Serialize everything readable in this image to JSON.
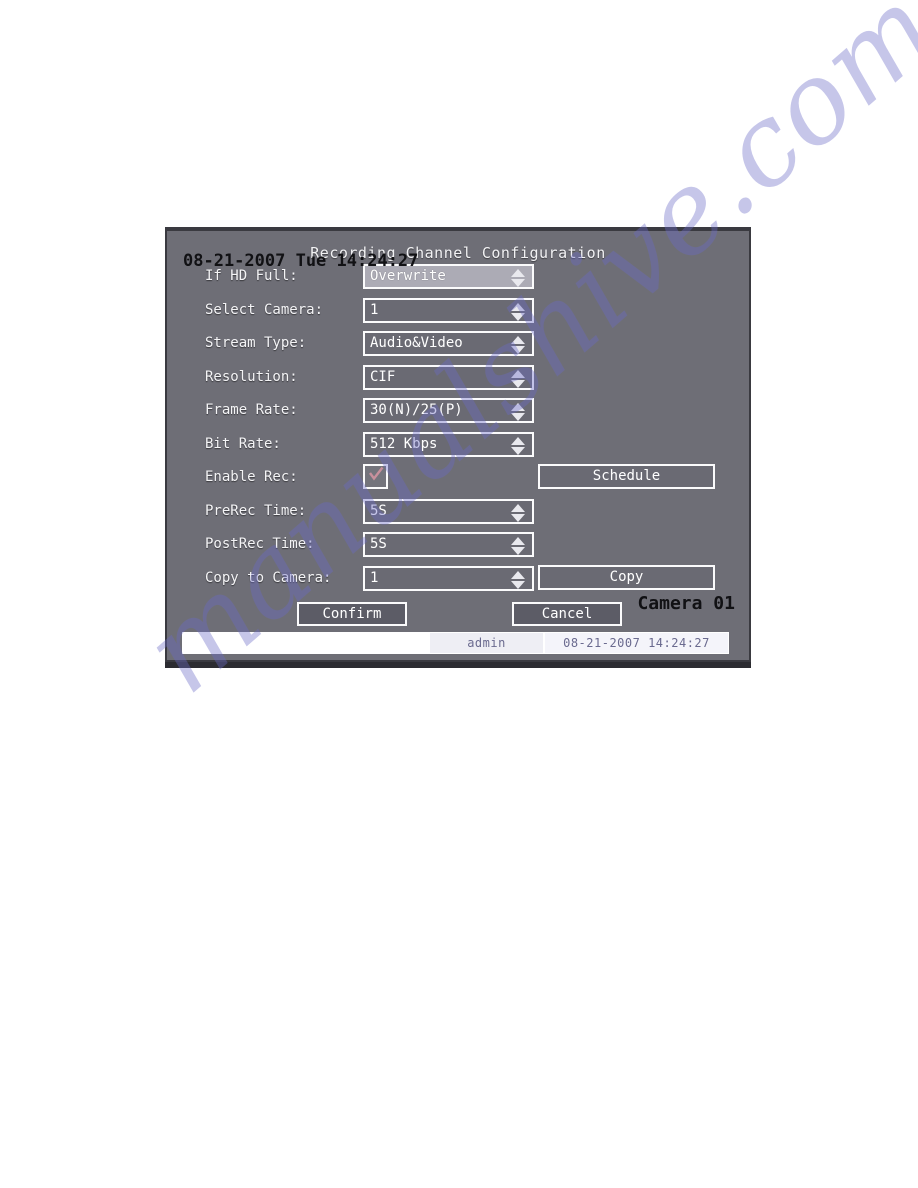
{
  "page": {
    "background_color": "#ffffff",
    "watermark_text": "manualshive.com",
    "watermark_color": "#6b6bc8"
  },
  "dvr": {
    "screen_background": "#6e6e76",
    "bezel_color": "#3a3a40",
    "accent_border": "#fbfbfc",
    "osd": {
      "datetime": "08-21-2007 Tue 14:24:27",
      "camera": "Camera 01"
    },
    "dialog": {
      "title": "Recording Channel Configuration",
      "rows": [
        {
          "label": "If HD Full:",
          "control": "spinner",
          "value": "Overwrite",
          "focused": true,
          "name": "if-hd-full"
        },
        {
          "label": "Select Camera:",
          "control": "spinner",
          "value": "1",
          "focused": false,
          "name": "select-camera"
        },
        {
          "label": "Stream Type:",
          "control": "spinner",
          "value": "Audio&Video",
          "focused": false,
          "name": "stream-type"
        },
        {
          "label": "Resolution:",
          "control": "spinner",
          "value": "CIF",
          "focused": false,
          "name": "resolution"
        },
        {
          "label": "Frame Rate:",
          "control": "spinner",
          "value": "30(N)/25(P)",
          "focused": false,
          "name": "frame-rate"
        },
        {
          "label": "Bit Rate:",
          "control": "spinner",
          "value": "512 Kbps",
          "focused": false,
          "name": "bit-rate"
        },
        {
          "label": "Enable Rec:",
          "control": "checkbox",
          "checked": true,
          "check_color": "#c8909c",
          "button": "Schedule",
          "name": "enable-rec"
        },
        {
          "label": "PreRec Time:",
          "control": "spinner",
          "value": "5S",
          "focused": false,
          "name": "prerec-time"
        },
        {
          "label": "PostRec Time:",
          "control": "spinner",
          "value": "5S",
          "focused": false,
          "name": "postrec-time"
        },
        {
          "label": "Copy to Camera:",
          "control": "spinner",
          "value": "1",
          "focused": false,
          "button": "Copy",
          "name": "copy-to-camera"
        }
      ],
      "actions": {
        "confirm": "Confirm",
        "cancel": "Cancel"
      },
      "status_bar": {
        "blank": "",
        "user": "admin",
        "datetime": "08-21-2007 14:24:27"
      }
    }
  }
}
